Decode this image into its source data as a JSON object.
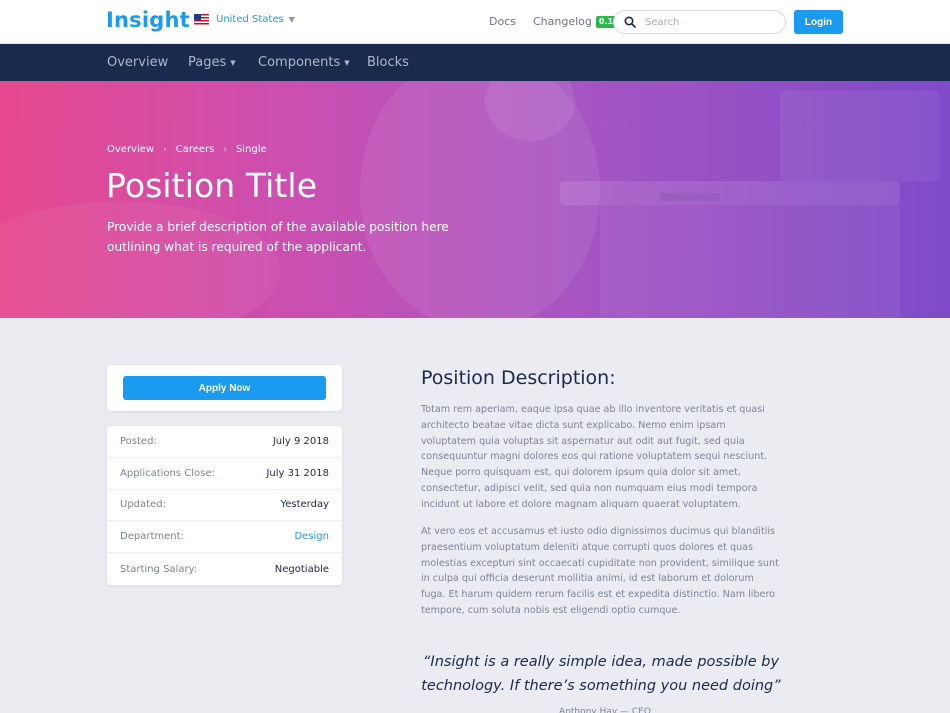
{
  "topbar": {
    "logo": "Insight",
    "locale": "United States",
    "docs": "Docs",
    "changelog": "Changelog",
    "changelog_badge": "0.1",
    "search_placeholder": "Search",
    "login": "Login"
  },
  "nav": {
    "items": [
      {
        "label": "Overview"
      },
      {
        "label": "Pages"
      },
      {
        "label": "Components"
      },
      {
        "label": "Blocks"
      }
    ]
  },
  "hero": {
    "breadcrumb": [
      "Overview",
      "Careers",
      "Single"
    ],
    "title": "Position Title",
    "description": "Provide a brief description of the available position here outlining what is required of the applicant."
  },
  "apply": {
    "button": "Apply Now"
  },
  "details": [
    {
      "label": "Posted:",
      "value": "July 9 2018"
    },
    {
      "label": "Applications Close:",
      "value": "July 31 2018"
    },
    {
      "label": "Updated:",
      "value": "Yesterday"
    },
    {
      "label": "Department:",
      "value": "Design"
    },
    {
      "label": "Starting Salary:",
      "value": "Negotiable"
    }
  ],
  "description": {
    "title": "Position Description:",
    "paragraphs": [
      "Totam rem aperiam, eaque ipsa quae ab illo inventore veritatis et quasi architecto beatae vitae dicta sunt explicabo. Nemo enim ipsam voluptatem quia voluptas sit aspernatur aut odit aut fugit, sed quia consequuntur magni dolores eos qui ratione voluptatem sequi nesciunt. Neque porro quisquam est, qui dolorem ipsum quia dolor sit amet, consectetur, adipisci velit, sed quia non numquam eius modi tempora incidunt ut labore et dolore magnam aliquam quaerat voluptatem.",
      "At vero eos et accusamus et iusto odio dignissimos ducimus qui blanditiis praesentium voluptatum deleniti atque corrupti quos dolores et quas molestias excepturi sint occaecati cupiditate non provident, similique sunt in culpa qui officia deserunt mollitia animi, id est laborum et dolorum fuga. Et harum quidem rerum facilis est et expedita distinctio. Nam libero tempore, cum soluta nobis est eligendi optio cumque."
    ],
    "quote": "“Insight is a really simple idea, made possible by technology. If there’s something you need doing”",
    "attribution": "Anthony Hay — CEO"
  },
  "colors": {
    "accent": "#1a9bf0",
    "navbar": "#1a2a4e",
    "badge": "#2db84d",
    "hero_start": "#e6498e",
    "hero_end": "#7f4bc9"
  }
}
